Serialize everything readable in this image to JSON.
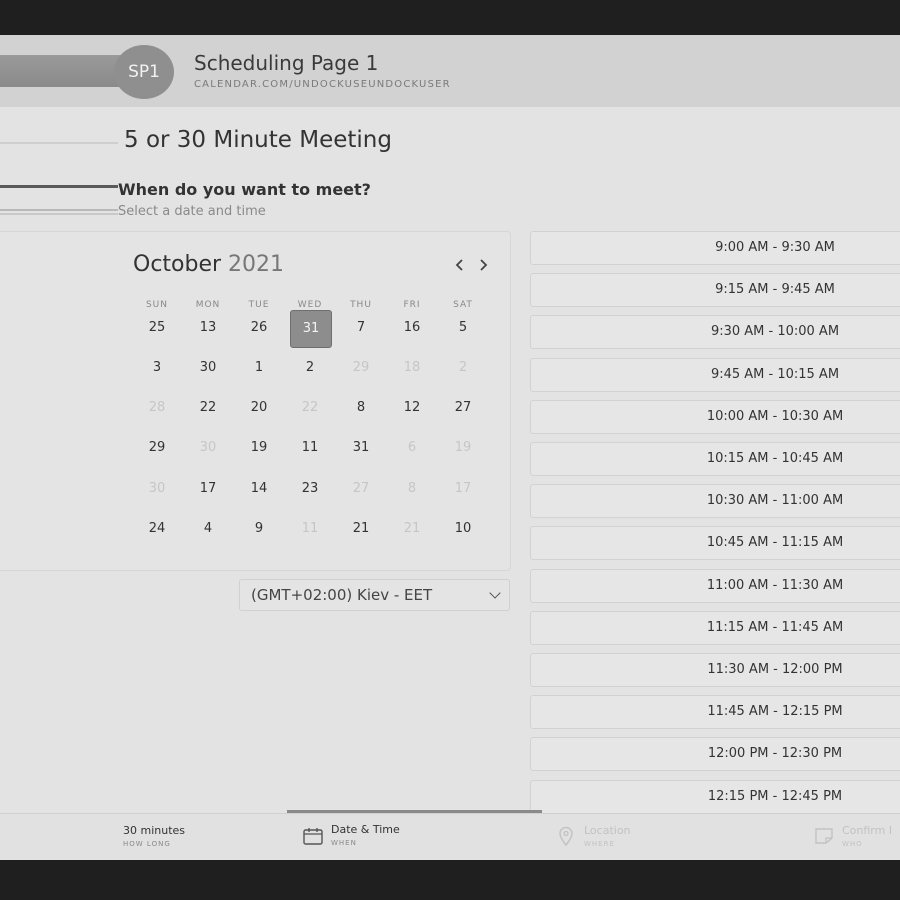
{
  "header": {
    "avatar_initials": "SP1",
    "title": "Scheduling Page 1",
    "url": "CALENDAR.COM/UNDOCKUSEUNDOCKUSER"
  },
  "meeting": {
    "title": "5 or 30 Minute Meeting",
    "question": "When do you want to meet?",
    "subtitle": "Select a date and time"
  },
  "calendar": {
    "month": "October",
    "year": "2021",
    "prev_icon": "‹",
    "next_icon": "›",
    "weekdays": [
      "SUN",
      "MON",
      "TUE",
      "WED",
      "THU",
      "FRI",
      "SAT"
    ],
    "weeks": [
      [
        {
          "d": "25"
        },
        {
          "d": "13"
        },
        {
          "d": "26"
        },
        {
          "d": "31",
          "selected": true
        },
        {
          "d": "7"
        },
        {
          "d": "16"
        },
        {
          "d": "5"
        }
      ],
      [
        {
          "d": "3"
        },
        {
          "d": "30"
        },
        {
          "d": "1"
        },
        {
          "d": "2"
        },
        {
          "d": "29",
          "muted": true
        },
        {
          "d": "18",
          "muted": true
        },
        {
          "d": "2",
          "muted": true
        }
      ],
      [
        {
          "d": "28",
          "muted": true
        },
        {
          "d": "22"
        },
        {
          "d": "20"
        },
        {
          "d": "22",
          "muted": true
        },
        {
          "d": "8"
        },
        {
          "d": "12"
        },
        {
          "d": "27"
        }
      ],
      [
        {
          "d": "29"
        },
        {
          "d": "30",
          "muted": true
        },
        {
          "d": "19"
        },
        {
          "d": "11"
        },
        {
          "d": "31"
        },
        {
          "d": "6",
          "muted": true
        },
        {
          "d": "19",
          "muted": true
        }
      ],
      [
        {
          "d": "30",
          "muted": true
        },
        {
          "d": "17"
        },
        {
          "d": "14"
        },
        {
          "d": "23"
        },
        {
          "d": "27",
          "muted": true
        },
        {
          "d": "8",
          "muted": true
        },
        {
          "d": "17",
          "muted": true
        }
      ],
      [
        {
          "d": "24"
        },
        {
          "d": "4"
        },
        {
          "d": "9"
        },
        {
          "d": "11",
          "muted": true
        },
        {
          "d": "21"
        },
        {
          "d": "21",
          "muted": true
        },
        {
          "d": "10"
        }
      ]
    ]
  },
  "timezone": {
    "label": "(GMT+02:00) Kiev - EET"
  },
  "time_slots": [
    "9:00 AM - 9:30 AM",
    "9:15 AM - 9:45 AM",
    "9:30 AM - 10:00 AM",
    "9:45 AM - 10:15 AM",
    "10:00 AM - 10:30 AM",
    "10:15 AM - 10:45 AM",
    "10:30 AM - 11:00 AM",
    "10:45 AM - 11:15 AM",
    "11:00 AM - 11:30 AM",
    "11:15 AM - 11:45 AM",
    "11:30 AM - 12:00 PM",
    "11:45 AM - 12:15 PM",
    "12:00 PM - 12:30 PM",
    "12:15 PM - 12:45 PM"
  ],
  "steps": [
    {
      "main": "30 minutes",
      "sub": "HOW LONG",
      "icon": "none"
    },
    {
      "main": "Date & Time",
      "sub": "WHEN",
      "icon": "calendar-icon"
    },
    {
      "main": "Location",
      "sub": "WHERE",
      "icon": "location-pin-icon"
    },
    {
      "main": "Confirm I",
      "sub": "WHO",
      "icon": "note-icon"
    }
  ]
}
